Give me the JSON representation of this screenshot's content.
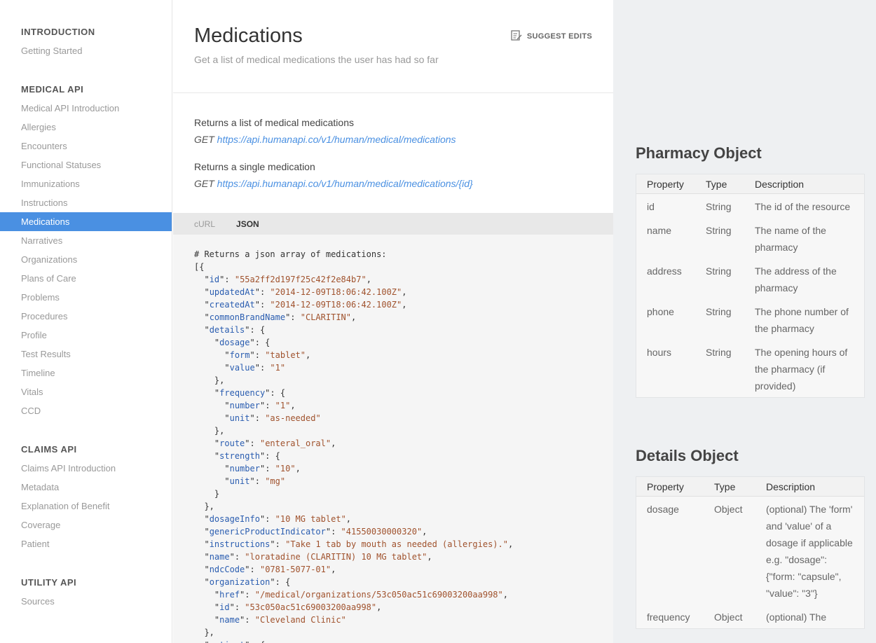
{
  "sidebar": {
    "sections": [
      {
        "title": "INTRODUCTION",
        "items": [
          "Getting Started"
        ]
      },
      {
        "title": "MEDICAL API",
        "items": [
          "Medical API Introduction",
          "Allergies",
          "Encounters",
          "Functional Statuses",
          "Immunizations",
          "Instructions",
          "Medications",
          "Narratives",
          "Organizations",
          "Plans of Care",
          "Problems",
          "Procedures",
          "Profile",
          "Test Results",
          "Timeline",
          "Vitals",
          "CCD"
        ]
      },
      {
        "title": "CLAIMS API",
        "items": [
          "Claims API Introduction",
          "Metadata",
          "Explanation of Benefit",
          "Coverage",
          "Patient"
        ]
      },
      {
        "title": "UTILITY API",
        "items": [
          "Sources"
        ]
      }
    ],
    "active_item": "Medications"
  },
  "header": {
    "title": "Medications",
    "subtitle": "Get a list of medical medications the user has had so far",
    "suggest_edits": "SUGGEST EDITS"
  },
  "endpoints": [
    {
      "description": "Returns a list of medical medications",
      "method": "GET",
      "url": "https://api.humanapi.co/v1/human/medical/medications"
    },
    {
      "description": "Returns a single medication",
      "method": "GET",
      "url": "https://api.humanapi.co/v1/human/medical/medications/{id}"
    }
  ],
  "code_tabs": {
    "tabs": [
      "cURL",
      "JSON"
    ],
    "active": "JSON"
  },
  "code": {
    "comment": "# Returns a json array of medications:",
    "lines": [
      {
        "i": 0,
        "t": "[{"
      },
      {
        "i": 1,
        "k": "id",
        "v": "55a2ff2d197f25c42f2e84b7",
        "c": ","
      },
      {
        "i": 1,
        "k": "updatedAt",
        "v": "2014-12-09T18:06:42.100Z",
        "c": ","
      },
      {
        "i": 1,
        "k": "createdAt",
        "v": "2014-12-09T18:06:42.100Z",
        "c": ","
      },
      {
        "i": 1,
        "k": "commonBrandName",
        "v": "CLARITIN",
        "c": ","
      },
      {
        "i": 1,
        "k": "details",
        "c": ": {"
      },
      {
        "i": 2,
        "k": "dosage",
        "c": ": {"
      },
      {
        "i": 3,
        "k": "form",
        "v": "tablet",
        "c": ","
      },
      {
        "i": 3,
        "k": "value",
        "v": "1",
        "c": ""
      },
      {
        "i": 2,
        "t": "},"
      },
      {
        "i": 2,
        "k": "frequency",
        "c": ": {"
      },
      {
        "i": 3,
        "k": "number",
        "v": "1",
        "c": ","
      },
      {
        "i": 3,
        "k": "unit",
        "v": "as-needed",
        "c": ""
      },
      {
        "i": 2,
        "t": "},"
      },
      {
        "i": 2,
        "k": "route",
        "v": "enteral_oral",
        "c": ","
      },
      {
        "i": 2,
        "k": "strength",
        "c": ": {"
      },
      {
        "i": 3,
        "k": "number",
        "v": "10",
        "c": ","
      },
      {
        "i": 3,
        "k": "unit",
        "v": "mg",
        "c": ""
      },
      {
        "i": 2,
        "t": "}"
      },
      {
        "i": 1,
        "t": "},"
      },
      {
        "i": 1,
        "k": "dosageInfo",
        "v": "10 MG tablet",
        "c": ","
      },
      {
        "i": 1,
        "k": "genericProductIndicator",
        "v": "41550030000320",
        "c": ","
      },
      {
        "i": 1,
        "k": "instructions",
        "v": "Take 1 tab by mouth as needed (allergies).",
        "c": ","
      },
      {
        "i": 1,
        "k": "name",
        "v": "loratadine (CLARITIN) 10 MG tablet",
        "c": ","
      },
      {
        "i": 1,
        "k": "ndcCode",
        "v": "0781-5077-01",
        "c": ","
      },
      {
        "i": 1,
        "k": "organization",
        "c": ": {"
      },
      {
        "i": 2,
        "k": "href",
        "v": "/medical/organizations/53c050ac51c69003200aa998",
        "c": ","
      },
      {
        "i": 2,
        "k": "id",
        "v": "53c050ac51c69003200aa998",
        "c": ","
      },
      {
        "i": 2,
        "k": "name",
        "v": "Cleveland Clinic",
        "c": ""
      },
      {
        "i": 1,
        "t": "},"
      },
      {
        "i": 1,
        "k": "patient",
        "c": ": {"
      }
    ]
  },
  "pharmacy_object": {
    "title": "Pharmacy Object",
    "headers": [
      "Property",
      "Type",
      "Description"
    ],
    "rows": [
      [
        "id",
        "String",
        "The id of the resource"
      ],
      [
        "name",
        "String",
        "The name of the pharmacy"
      ],
      [
        "address",
        "String",
        "The address of the pharmacy"
      ],
      [
        "phone",
        "String",
        "The phone number of the pharmacy"
      ],
      [
        "hours",
        "String",
        "The opening hours of the pharmacy (if provided)"
      ]
    ]
  },
  "details_object": {
    "title": "Details Object",
    "headers": [
      "Property",
      "Type",
      "Description"
    ],
    "rows": [
      [
        "dosage",
        "Object",
        "(optional) The 'form' and 'value' of a dosage if applicable e.g. \"dosage\": {\"form: \"capsule\", \"value\": \"3\"}"
      ],
      [
        "frequency",
        "Object",
        "(optional) The"
      ]
    ]
  }
}
